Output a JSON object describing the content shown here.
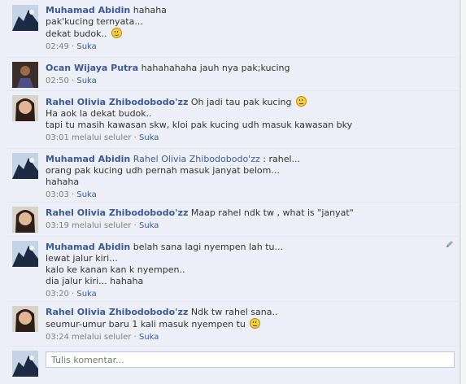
{
  "like_label": "Suka",
  "composer": {
    "placeholder": "Tulis komentar..."
  },
  "comments": [
    {
      "author": "Muhamad Abidin",
      "mention": "",
      "lines": [
        "hahaha",
        "pak'kucing ternyata...",
        "dekat budok.."
      ],
      "emoji": "smile-emoji",
      "time": "02:49",
      "via": ""
    },
    {
      "author": "Ocan Wijaya Putra",
      "mention": "",
      "lines": [
        "hahahahaha jauh nya pak;kucing"
      ],
      "time": "02:50",
      "via": ""
    },
    {
      "author": "Rahel Olivia Zhibodobodo'zz",
      "mention": "",
      "lines": [
        "Oh jadi tau pak kucing",
        "Ha aok la dekat budok..",
        "tapi tu masih kawasan skw, kloi pak kucing udh masuk kawasan bky"
      ],
      "emoji": "straight-face-emoji",
      "time": "03:01",
      "via": "melalui seluler"
    },
    {
      "author": "Muhamad Abidin",
      "mention": "Rahel Olivia Zhibodobodo'zz",
      "lines": [
        ": rahel...",
        "orang pak kucing udh pernah masuk janyat belom...",
        "hahaha"
      ],
      "time": "03:03",
      "via": ""
    },
    {
      "author": "Rahel Olivia Zhibodobodo'zz",
      "mention": "",
      "lines": [
        "Maap rahel ndk tw , what is \"janyat\""
      ],
      "time": "03:19",
      "via": "melalui seluler"
    },
    {
      "author": "Muhamad Abidin",
      "mention": "",
      "lines": [
        "belah sana lagi nyempen lah tu...",
        "lewat jalur kiri...",
        "kalo ke kanan kan k nyempen..",
        "dia jalur kiri... hahaha"
      ],
      "time": "03:20",
      "via": ""
    },
    {
      "author": "Rahel Olivia Zhibodobodo'zz",
      "mention": "",
      "lines": [
        "Ndk tw rahel sana..",
        "seumur-umur baru 1 kali masuk nyempen tu"
      ],
      "emoji": "straight-face-emoji",
      "time": "03:24",
      "via": "melalui seluler"
    }
  ]
}
